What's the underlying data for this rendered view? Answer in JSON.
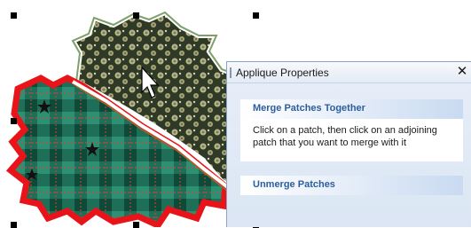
{
  "panel": {
    "title": "Applique Properties",
    "close_symbol": "✕",
    "sections": [
      {
        "header": "Merge Patches Together",
        "body": "Click on a patch, then click on an adjoining patch that you want to merge with it"
      },
      {
        "header": "Unmerge Patches"
      }
    ]
  },
  "canvas": {
    "patches": [
      {
        "name": "floral-patch",
        "fill": "#3a4a30",
        "outline": "#ffffff"
      },
      {
        "name": "plaid-patch",
        "fill": "#1f6e58",
        "outline": "#e8141a"
      }
    ],
    "icons": [
      "mouse-cursor-icon",
      "selection-handle-icon"
    ]
  }
}
